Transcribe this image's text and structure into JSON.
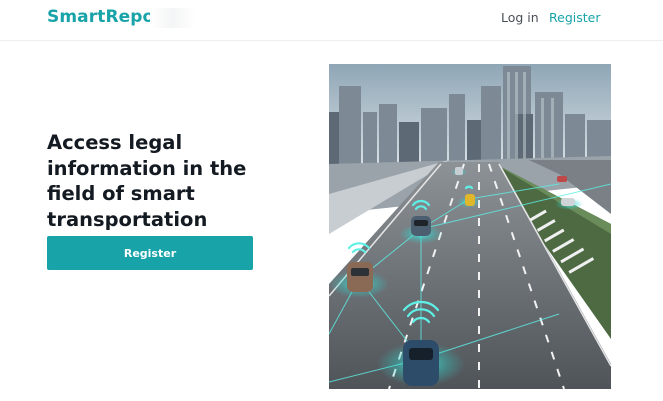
{
  "header": {
    "logo": "SmartRepo",
    "login_label": "Log in",
    "register_label": "Register"
  },
  "hero": {
    "headline": "Access legal information in the field of smart transportation",
    "cta_label": "Register",
    "image_icon": "smart-traffic-highway-image"
  },
  "colors": {
    "accent": "#17a3a8",
    "heading": "#141a22",
    "nav_text": "#4a4f57"
  }
}
